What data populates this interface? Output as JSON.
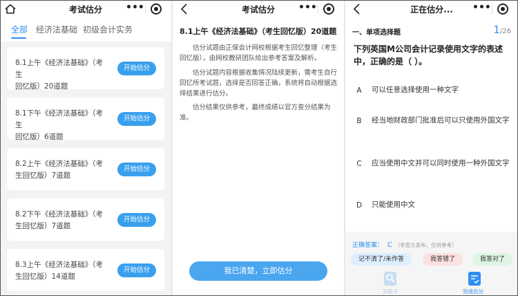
{
  "panel1": {
    "title": "考试估分",
    "tabs": [
      "全部",
      "经济法基础",
      "初级会计实务"
    ],
    "cards": [
      {
        "line1": "8.1上午《经济法基础》（考生",
        "line2": "回忆版）20道题"
      },
      {
        "line1": "8.1下午《经济法基础》（考生",
        "line2": "回忆版）6道题"
      },
      {
        "line1": "8.2上午《经济法基础》（考",
        "line2": "生回忆版）7道题"
      },
      {
        "line1": "8.2下午《经济法基础》（考",
        "line2": "生回忆版）7道题"
      },
      {
        "line1": "8.3上午《经济法基础》（考",
        "line2": "生回忆版）14道题"
      }
    ],
    "button_label": "开始估分",
    "menu_dots": "•••"
  },
  "panel2": {
    "title": "考试估分",
    "heading": "8.1上午《经济法基础》（考生回忆版）20道题",
    "paragraphs": [
      "估分试题由正保会计网校根据考生回忆整理（考生回忆版），由网校教研团队给出参考答案及解析。",
      "估分试题内容根据收集情况陆续更新，需考生自行回忆所考试题，选择是否回答正确，系统将自动根据选择结果进行估分。",
      "估分结果仅供参考，最终成绩以官方查分结果为准。"
    ],
    "confirm_label": "我已清楚，立即估分"
  },
  "panel3": {
    "title": "正在估分...",
    "question_type": "一、单项选择题",
    "progress_current": "1",
    "progress_total": "/26",
    "question": "下列英国M公司会计记录使用文字的表述中，正确的是（  ）。",
    "options": [
      {
        "letter": "A",
        "text": "可以任意选择使用一种文字"
      },
      {
        "letter": "B",
        "text": "经当地财政部门批准后可以只使用外国文字"
      },
      {
        "letter": "C",
        "text": "应当使用中文并可以同时使用一种外国文字"
      },
      {
        "letter": "D",
        "text": "只能使用中文"
      }
    ],
    "answer_label": "正确答案：",
    "answer_value": "C",
    "answer_note": "（非官方发布，仅供参考）",
    "pills": [
      "记不清了/未作答",
      "我答错了",
      "我答对了"
    ],
    "tabbar": [
      "答题卡",
      "完成估分"
    ]
  },
  "colors": {
    "accent": "#2f8ef2",
    "button": "#3aa0ee"
  }
}
